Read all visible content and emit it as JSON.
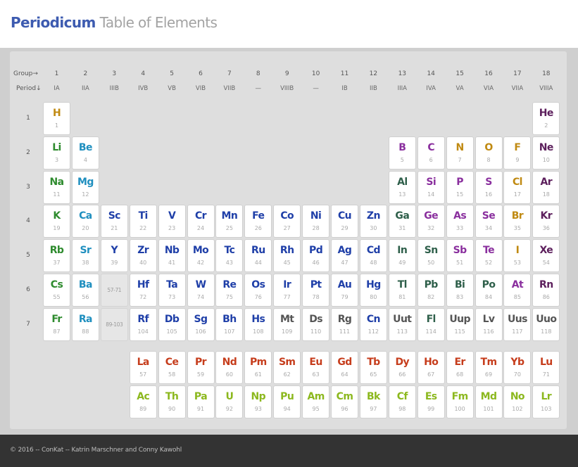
{
  "header": {
    "brand": "Periodicum",
    "subtitle": "Table of Elements"
  },
  "table_header": {
    "group_label": "Group→",
    "period_label": "Period↓",
    "groups": [
      {
        "num": "1",
        "sub": "IA"
      },
      {
        "num": "2",
        "sub": "IIA"
      },
      {
        "num": "3",
        "sub": "IIIB"
      },
      {
        "num": "4",
        "sub": "IVB"
      },
      {
        "num": "5",
        "sub": "VB"
      },
      {
        "num": "6",
        "sub": "VIB"
      },
      {
        "num": "7",
        "sub": "VIIB"
      },
      {
        "num": "8",
        "sub": "—"
      },
      {
        "num": "9",
        "sub": "VIIIB"
      },
      {
        "num": "10",
        "sub": "—"
      },
      {
        "num": "11",
        "sub": "IB"
      },
      {
        "num": "12",
        "sub": "IIB"
      },
      {
        "num": "13",
        "sub": "IIIA"
      },
      {
        "num": "14",
        "sub": "IVA"
      },
      {
        "num": "15",
        "sub": "VA"
      },
      {
        "num": "16",
        "sub": "VIA"
      },
      {
        "num": "17",
        "sub": "VIIA"
      },
      {
        "num": "18",
        "sub": "VIIIA"
      }
    ],
    "periods": [
      "1",
      "2",
      "3",
      "4",
      "5",
      "6",
      "7"
    ]
  },
  "placeholders": [
    {
      "label": "57-71",
      "period": 6,
      "group": 3
    },
    {
      "label": "89-103",
      "period": 7,
      "group": 3
    }
  ],
  "colors": {
    "alkali": "#2e8b2e",
    "alkaline": "#1f8fbf",
    "transition": "#1f3fa8",
    "post": "#2e5f4a",
    "metalloid": "#8a2f9e",
    "nonmetal": "#c08a12",
    "noble": "#5c1f5c",
    "lanthanide": "#c63d1c",
    "actinide": "#8cb81e",
    "unknown": "#555555"
  },
  "elements": [
    {
      "s": "H",
      "n": 1,
      "p": 1,
      "g": 1,
      "c": "nonmetal"
    },
    {
      "s": "He",
      "n": 2,
      "p": 1,
      "g": 18,
      "c": "noble"
    },
    {
      "s": "Li",
      "n": 3,
      "p": 2,
      "g": 1,
      "c": "alkali"
    },
    {
      "s": "Be",
      "n": 4,
      "p": 2,
      "g": 2,
      "c": "alkaline"
    },
    {
      "s": "B",
      "n": 5,
      "p": 2,
      "g": 13,
      "c": "metalloid"
    },
    {
      "s": "C",
      "n": 6,
      "p": 2,
      "g": 14,
      "c": "metalloid"
    },
    {
      "s": "N",
      "n": 7,
      "p": 2,
      "g": 15,
      "c": "nonmetal"
    },
    {
      "s": "O",
      "n": 8,
      "p": 2,
      "g": 16,
      "c": "nonmetal"
    },
    {
      "s": "F",
      "n": 9,
      "p": 2,
      "g": 17,
      "c": "nonmetal"
    },
    {
      "s": "Ne",
      "n": 10,
      "p": 2,
      "g": 18,
      "c": "noble"
    },
    {
      "s": "Na",
      "n": 11,
      "p": 3,
      "g": 1,
      "c": "alkali"
    },
    {
      "s": "Mg",
      "n": 12,
      "p": 3,
      "g": 2,
      "c": "alkaline"
    },
    {
      "s": "Al",
      "n": 13,
      "p": 3,
      "g": 13,
      "c": "post"
    },
    {
      "s": "Si",
      "n": 14,
      "p": 3,
      "g": 14,
      "c": "metalloid"
    },
    {
      "s": "P",
      "n": 15,
      "p": 3,
      "g": 15,
      "c": "metalloid"
    },
    {
      "s": "S",
      "n": 16,
      "p": 3,
      "g": 16,
      "c": "metalloid"
    },
    {
      "s": "Cl",
      "n": 17,
      "p": 3,
      "g": 17,
      "c": "nonmetal"
    },
    {
      "s": "Ar",
      "n": 18,
      "p": 3,
      "g": 18,
      "c": "noble"
    },
    {
      "s": "K",
      "n": 19,
      "p": 4,
      "g": 1,
      "c": "alkali"
    },
    {
      "s": "Ca",
      "n": 20,
      "p": 4,
      "g": 2,
      "c": "alkaline"
    },
    {
      "s": "Sc",
      "n": 21,
      "p": 4,
      "g": 3,
      "c": "transition"
    },
    {
      "s": "Ti",
      "n": 22,
      "p": 4,
      "g": 4,
      "c": "transition"
    },
    {
      "s": "V",
      "n": 23,
      "p": 4,
      "g": 5,
      "c": "transition"
    },
    {
      "s": "Cr",
      "n": 24,
      "p": 4,
      "g": 6,
      "c": "transition"
    },
    {
      "s": "Mn",
      "n": 25,
      "p": 4,
      "g": 7,
      "c": "transition"
    },
    {
      "s": "Fe",
      "n": 26,
      "p": 4,
      "g": 8,
      "c": "transition"
    },
    {
      "s": "Co",
      "n": 27,
      "p": 4,
      "g": 9,
      "c": "transition"
    },
    {
      "s": "Ni",
      "n": 28,
      "p": 4,
      "g": 10,
      "c": "transition"
    },
    {
      "s": "Cu",
      "n": 29,
      "p": 4,
      "g": 11,
      "c": "transition"
    },
    {
      "s": "Zn",
      "n": 30,
      "p": 4,
      "g": 12,
      "c": "transition"
    },
    {
      "s": "Ga",
      "n": 31,
      "p": 4,
      "g": 13,
      "c": "post"
    },
    {
      "s": "Ge",
      "n": 32,
      "p": 4,
      "g": 14,
      "c": "metalloid"
    },
    {
      "s": "As",
      "n": 33,
      "p": 4,
      "g": 15,
      "c": "metalloid"
    },
    {
      "s": "Se",
      "n": 34,
      "p": 4,
      "g": 16,
      "c": "metalloid"
    },
    {
      "s": "Br",
      "n": 35,
      "p": 4,
      "g": 17,
      "c": "nonmetal"
    },
    {
      "s": "Kr",
      "n": 36,
      "p": 4,
      "g": 18,
      "c": "noble"
    },
    {
      "s": "Rb",
      "n": 37,
      "p": 5,
      "g": 1,
      "c": "alkali"
    },
    {
      "s": "Sr",
      "n": 38,
      "p": 5,
      "g": 2,
      "c": "alkaline"
    },
    {
      "s": "Y",
      "n": 39,
      "p": 5,
      "g": 3,
      "c": "transition"
    },
    {
      "s": "Zr",
      "n": 40,
      "p": 5,
      "g": 4,
      "c": "transition"
    },
    {
      "s": "Nb",
      "n": 41,
      "p": 5,
      "g": 5,
      "c": "transition"
    },
    {
      "s": "Mo",
      "n": 42,
      "p": 5,
      "g": 6,
      "c": "transition"
    },
    {
      "s": "Tc",
      "n": 43,
      "p": 5,
      "g": 7,
      "c": "transition"
    },
    {
      "s": "Ru",
      "n": 44,
      "p": 5,
      "g": 8,
      "c": "transition"
    },
    {
      "s": "Rh",
      "n": 45,
      "p": 5,
      "g": 9,
      "c": "transition"
    },
    {
      "s": "Pd",
      "n": 46,
      "p": 5,
      "g": 10,
      "c": "transition"
    },
    {
      "s": "Ag",
      "n": 47,
      "p": 5,
      "g": 11,
      "c": "transition"
    },
    {
      "s": "Cd",
      "n": 48,
      "p": 5,
      "g": 12,
      "c": "transition"
    },
    {
      "s": "In",
      "n": 49,
      "p": 5,
      "g": 13,
      "c": "post"
    },
    {
      "s": "Sn",
      "n": 50,
      "p": 5,
      "g": 14,
      "c": "post"
    },
    {
      "s": "Sb",
      "n": 51,
      "p": 5,
      "g": 15,
      "c": "metalloid"
    },
    {
      "s": "Te",
      "n": 52,
      "p": 5,
      "g": 16,
      "c": "metalloid"
    },
    {
      "s": "I",
      "n": 53,
      "p": 5,
      "g": 17,
      "c": "nonmetal"
    },
    {
      "s": "Xe",
      "n": 54,
      "p": 5,
      "g": 18,
      "c": "noble"
    },
    {
      "s": "Cs",
      "n": 55,
      "p": 6,
      "g": 1,
      "c": "alkali"
    },
    {
      "s": "Ba",
      "n": 56,
      "p": 6,
      "g": 2,
      "c": "alkaline"
    },
    {
      "s": "Hf",
      "n": 72,
      "p": 6,
      "g": 4,
      "c": "transition"
    },
    {
      "s": "Ta",
      "n": 73,
      "p": 6,
      "g": 5,
      "c": "transition"
    },
    {
      "s": "W",
      "n": 74,
      "p": 6,
      "g": 6,
      "c": "transition"
    },
    {
      "s": "Re",
      "n": 75,
      "p": 6,
      "g": 7,
      "c": "transition"
    },
    {
      "s": "Os",
      "n": 76,
      "p": 6,
      "g": 8,
      "c": "transition"
    },
    {
      "s": "Ir",
      "n": 77,
      "p": 6,
      "g": 9,
      "c": "transition"
    },
    {
      "s": "Pt",
      "n": 78,
      "p": 6,
      "g": 10,
      "c": "transition"
    },
    {
      "s": "Au",
      "n": 79,
      "p": 6,
      "g": 11,
      "c": "transition"
    },
    {
      "s": "Hg",
      "n": 80,
      "p": 6,
      "g": 12,
      "c": "transition"
    },
    {
      "s": "Tl",
      "n": 81,
      "p": 6,
      "g": 13,
      "c": "post"
    },
    {
      "s": "Pb",
      "n": 82,
      "p": 6,
      "g": 14,
      "c": "post"
    },
    {
      "s": "Bi",
      "n": 83,
      "p": 6,
      "g": 15,
      "c": "post"
    },
    {
      "s": "Po",
      "n": 84,
      "p": 6,
      "g": 16,
      "c": "post"
    },
    {
      "s": "At",
      "n": 85,
      "p": 6,
      "g": 17,
      "c": "metalloid"
    },
    {
      "s": "Rn",
      "n": 86,
      "p": 6,
      "g": 18,
      "c": "noble"
    },
    {
      "s": "Fr",
      "n": 87,
      "p": 7,
      "g": 1,
      "c": "alkali"
    },
    {
      "s": "Ra",
      "n": 88,
      "p": 7,
      "g": 2,
      "c": "alkaline"
    },
    {
      "s": "Rf",
      "n": 104,
      "p": 7,
      "g": 4,
      "c": "transition"
    },
    {
      "s": "Db",
      "n": 105,
      "p": 7,
      "g": 5,
      "c": "transition"
    },
    {
      "s": "Sg",
      "n": 106,
      "p": 7,
      "g": 6,
      "c": "transition"
    },
    {
      "s": "Bh",
      "n": 107,
      "p": 7,
      "g": 7,
      "c": "transition"
    },
    {
      "s": "Hs",
      "n": 108,
      "p": 7,
      "g": 8,
      "c": "transition"
    },
    {
      "s": "Mt",
      "n": 109,
      "p": 7,
      "g": 9,
      "c": "unknown"
    },
    {
      "s": "Ds",
      "n": 110,
      "p": 7,
      "g": 10,
      "c": "unknown"
    },
    {
      "s": "Rg",
      "n": 111,
      "p": 7,
      "g": 11,
      "c": "unknown"
    },
    {
      "s": "Cn",
      "n": 112,
      "p": 7,
      "g": 12,
      "c": "transition"
    },
    {
      "s": "Uut",
      "n": 113,
      "p": 7,
      "g": 13,
      "c": "unknown"
    },
    {
      "s": "Fl",
      "n": 114,
      "p": 7,
      "g": 14,
      "c": "post"
    },
    {
      "s": "Uup",
      "n": 115,
      "p": 7,
      "g": 15,
      "c": "unknown"
    },
    {
      "s": "Lv",
      "n": 116,
      "p": 7,
      "g": 16,
      "c": "unknown"
    },
    {
      "s": "Uus",
      "n": 117,
      "p": 7,
      "g": 17,
      "c": "unknown"
    },
    {
      "s": "Uuo",
      "n": 118,
      "p": 7,
      "g": 18,
      "c": "unknown"
    },
    {
      "s": "La",
      "n": 57,
      "p": 9,
      "g": 4,
      "c": "lanthanide"
    },
    {
      "s": "Ce",
      "n": 58,
      "p": 9,
      "g": 5,
      "c": "lanthanide"
    },
    {
      "s": "Pr",
      "n": 59,
      "p": 9,
      "g": 6,
      "c": "lanthanide"
    },
    {
      "s": "Nd",
      "n": 60,
      "p": 9,
      "g": 7,
      "c": "lanthanide"
    },
    {
      "s": "Pm",
      "n": 61,
      "p": 9,
      "g": 8,
      "c": "lanthanide"
    },
    {
      "s": "Sm",
      "n": 62,
      "p": 9,
      "g": 9,
      "c": "lanthanide"
    },
    {
      "s": "Eu",
      "n": 63,
      "p": 9,
      "g": 10,
      "c": "lanthanide"
    },
    {
      "s": "Gd",
      "n": 64,
      "p": 9,
      "g": 11,
      "c": "lanthanide"
    },
    {
      "s": "Tb",
      "n": 65,
      "p": 9,
      "g": 12,
      "c": "lanthanide"
    },
    {
      "s": "Dy",
      "n": 66,
      "p": 9,
      "g": 13,
      "c": "lanthanide"
    },
    {
      "s": "Ho",
      "n": 67,
      "p": 9,
      "g": 14,
      "c": "lanthanide"
    },
    {
      "s": "Er",
      "n": 68,
      "p": 9,
      "g": 15,
      "c": "lanthanide"
    },
    {
      "s": "Tm",
      "n": 69,
      "p": 9,
      "g": 16,
      "c": "lanthanide"
    },
    {
      "s": "Yb",
      "n": 70,
      "p": 9,
      "g": 17,
      "c": "lanthanide"
    },
    {
      "s": "Lu",
      "n": 71,
      "p": 9,
      "g": 18,
      "c": "lanthanide"
    },
    {
      "s": "Ac",
      "n": 89,
      "p": 10,
      "g": 4,
      "c": "actinide"
    },
    {
      "s": "Th",
      "n": 90,
      "p": 10,
      "g": 5,
      "c": "actinide"
    },
    {
      "s": "Pa",
      "n": 91,
      "p": 10,
      "g": 6,
      "c": "actinide"
    },
    {
      "s": "U",
      "n": 92,
      "p": 10,
      "g": 7,
      "c": "actinide"
    },
    {
      "s": "Np",
      "n": 93,
      "p": 10,
      "g": 8,
      "c": "actinide"
    },
    {
      "s": "Pu",
      "n": 94,
      "p": 10,
      "g": 9,
      "c": "actinide"
    },
    {
      "s": "Am",
      "n": 95,
      "p": 10,
      "g": 10,
      "c": "actinide"
    },
    {
      "s": "Cm",
      "n": 96,
      "p": 10,
      "g": 11,
      "c": "actinide"
    },
    {
      "s": "Bk",
      "n": 97,
      "p": 10,
      "g": 12,
      "c": "actinide"
    },
    {
      "s": "Cf",
      "n": 98,
      "p": 10,
      "g": 13,
      "c": "actinide"
    },
    {
      "s": "Es",
      "n": 99,
      "p": 10,
      "g": 14,
      "c": "actinide"
    },
    {
      "s": "Fm",
      "n": 100,
      "p": 10,
      "g": 15,
      "c": "actinide"
    },
    {
      "s": "Md",
      "n": 101,
      "p": 10,
      "g": 16,
      "c": "actinide"
    },
    {
      "s": "No",
      "n": 102,
      "p": 10,
      "g": 17,
      "c": "actinide"
    },
    {
      "s": "Lr",
      "n": 103,
      "p": 10,
      "g": 18,
      "c": "actinide"
    }
  ],
  "footer": {
    "text": "© 2016 -- ConKat -- Katrin Marschner and Conny Kawohl"
  }
}
